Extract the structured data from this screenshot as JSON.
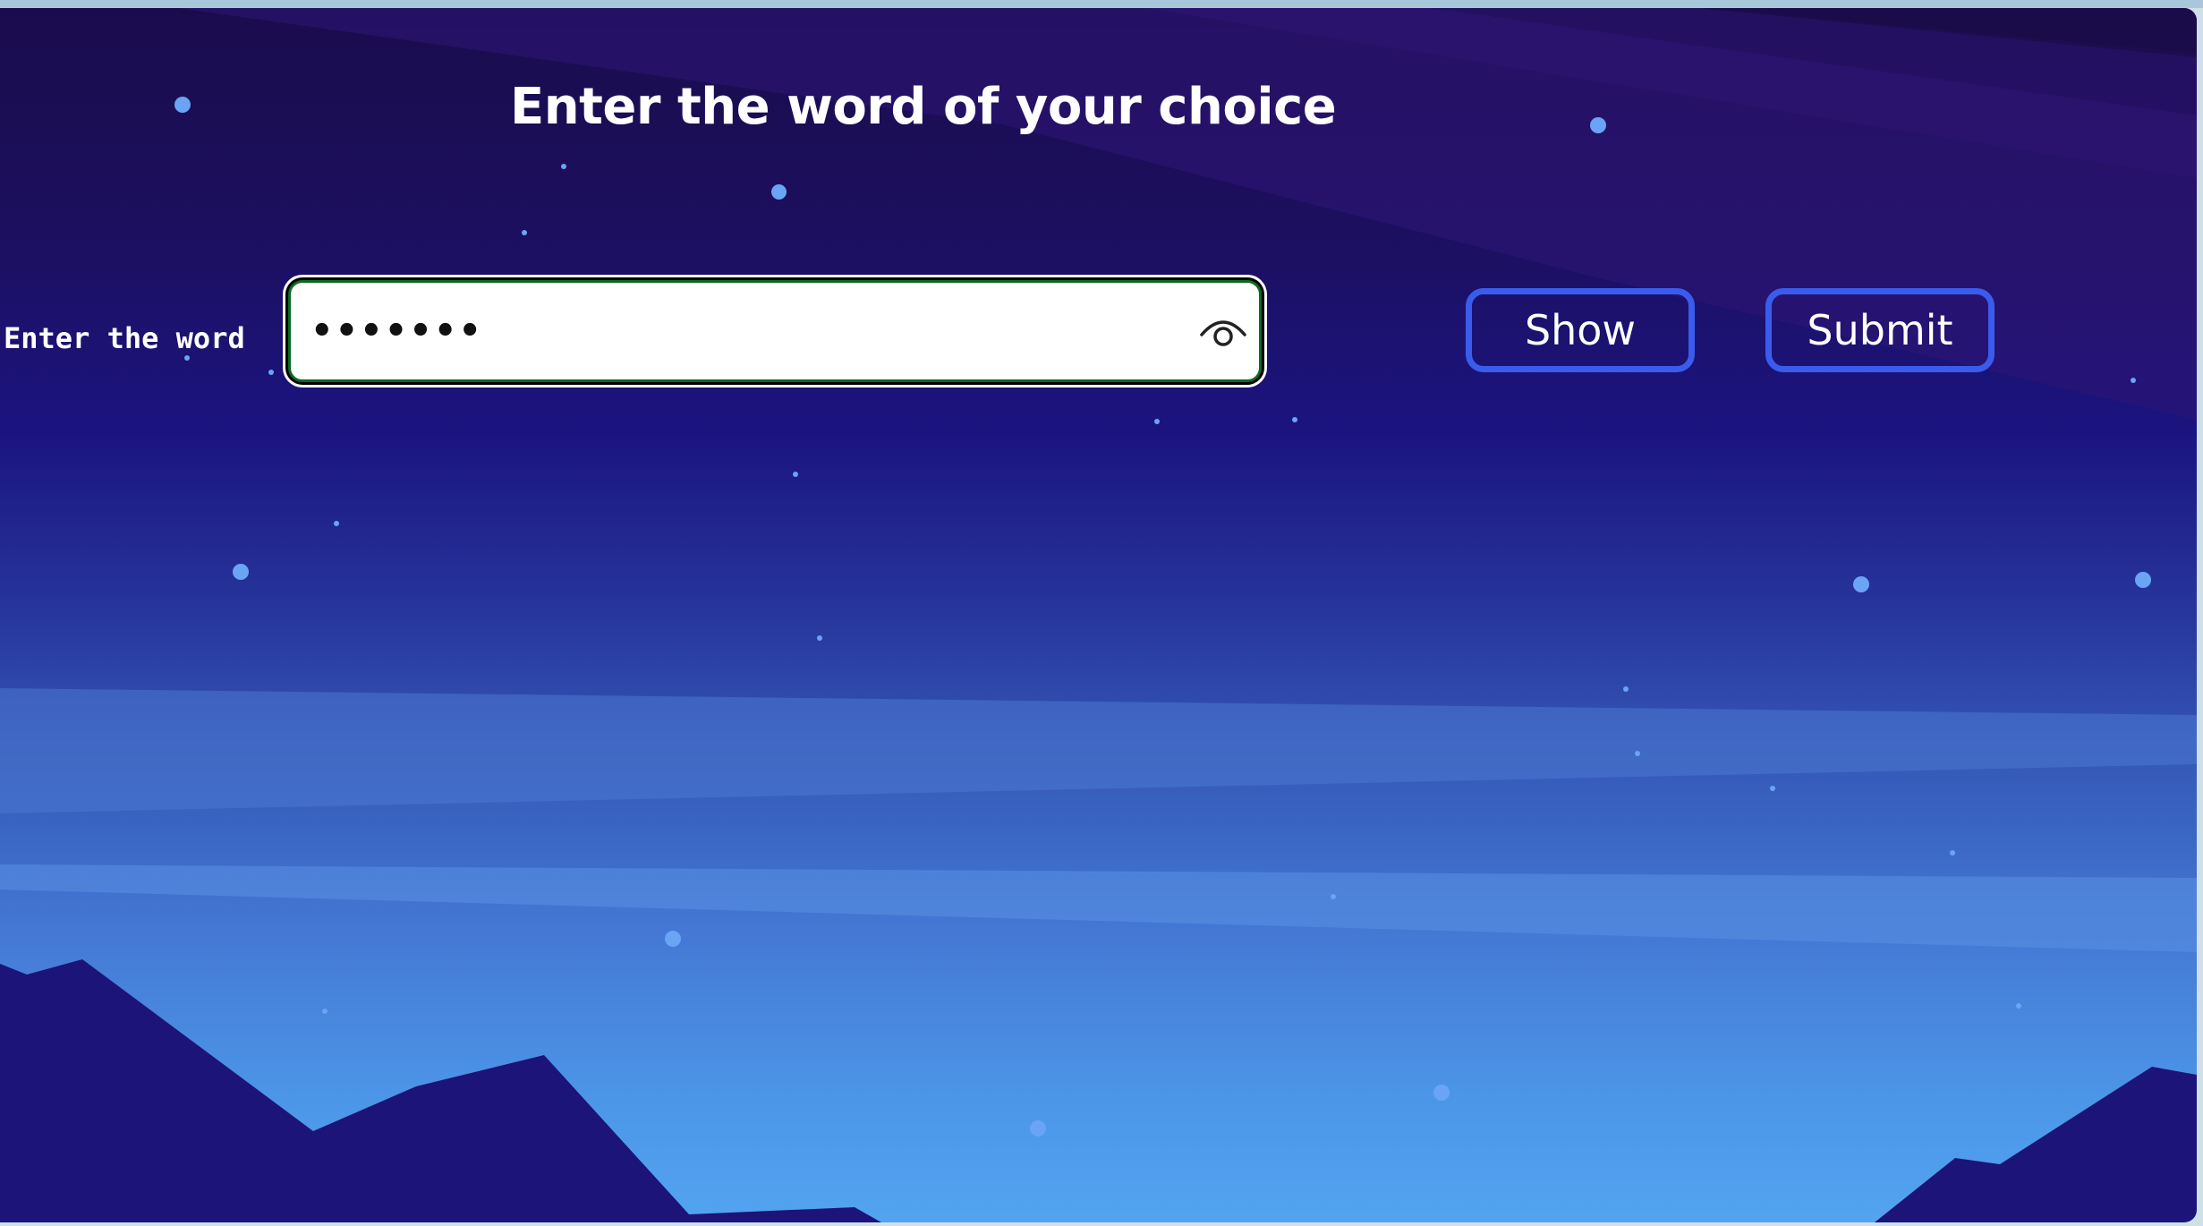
{
  "page": {
    "title": "Enter the word of your choice"
  },
  "form": {
    "label": "Enter the word",
    "input_value": "•••••••",
    "input_type": "password",
    "show_button": "Show",
    "submit_button": "Submit"
  },
  "icons": {
    "visibility_toggle": "eye-icon"
  },
  "colors": {
    "sky_top": "#1a0c4c",
    "sky_bottom": "#52a4f0",
    "mountains": "#1c1478",
    "button_border": "#3a5cec",
    "input_border": "#0b6b22",
    "star": "#6aa4f5"
  }
}
